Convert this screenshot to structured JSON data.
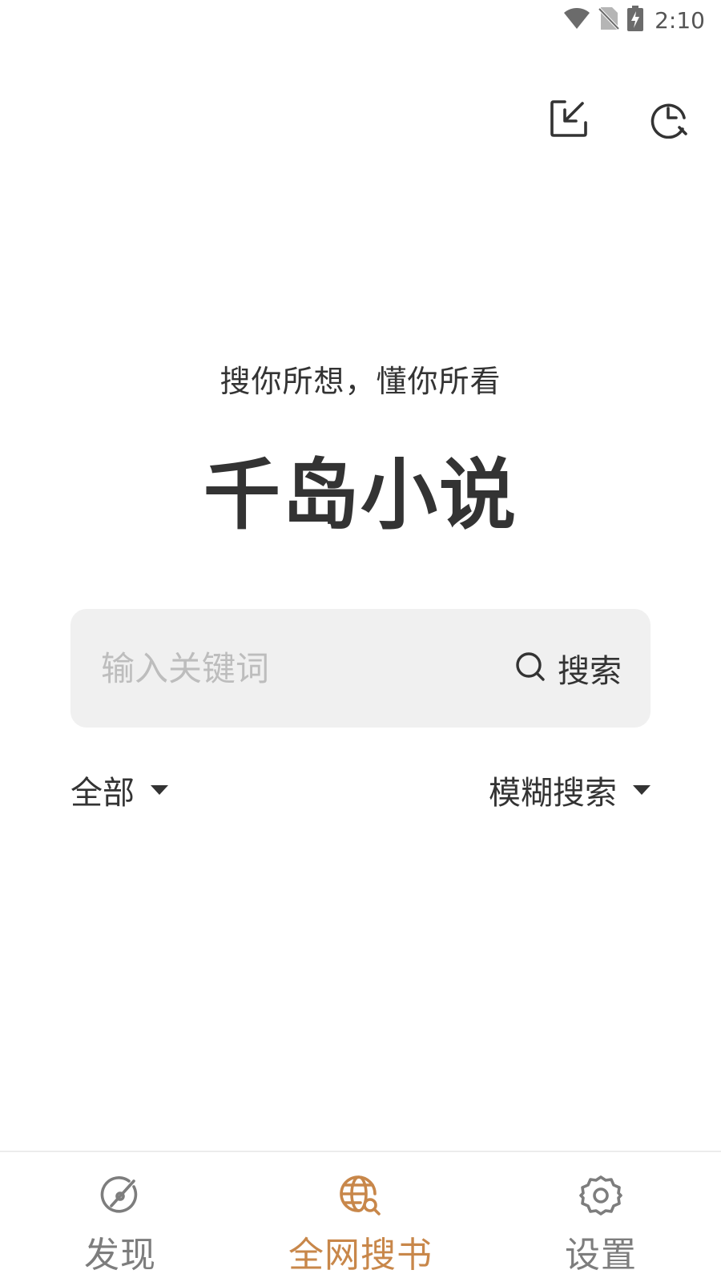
{
  "status_bar": {
    "time": "2:10",
    "icons": [
      "wifi-icon",
      "no-sim-icon",
      "battery-charging-icon"
    ]
  },
  "top_actions": {
    "import_icon": "import-book-icon",
    "history_icon": "history-clock-icon"
  },
  "header": {
    "slogan": "搜你所想，懂你所看",
    "app_title": "千岛小说"
  },
  "search": {
    "placeholder": "输入关键词",
    "value": "",
    "button_label": "搜索"
  },
  "filters": {
    "scope_label": "全部",
    "mode_label": "模糊搜索"
  },
  "bottom_nav": {
    "items": [
      {
        "label": "发现",
        "icon": "discover-compass-icon",
        "active": false
      },
      {
        "label": "全网搜书",
        "icon": "web-search-globe-icon",
        "active": true
      },
      {
        "label": "设置",
        "icon": "settings-gear-icon",
        "active": false
      }
    ]
  },
  "colors": {
    "accent": "#c8874a",
    "text": "#333333",
    "inactive": "#7d7d7d",
    "search_bg": "#f0f0f0",
    "placeholder": "#bdbdbd"
  }
}
